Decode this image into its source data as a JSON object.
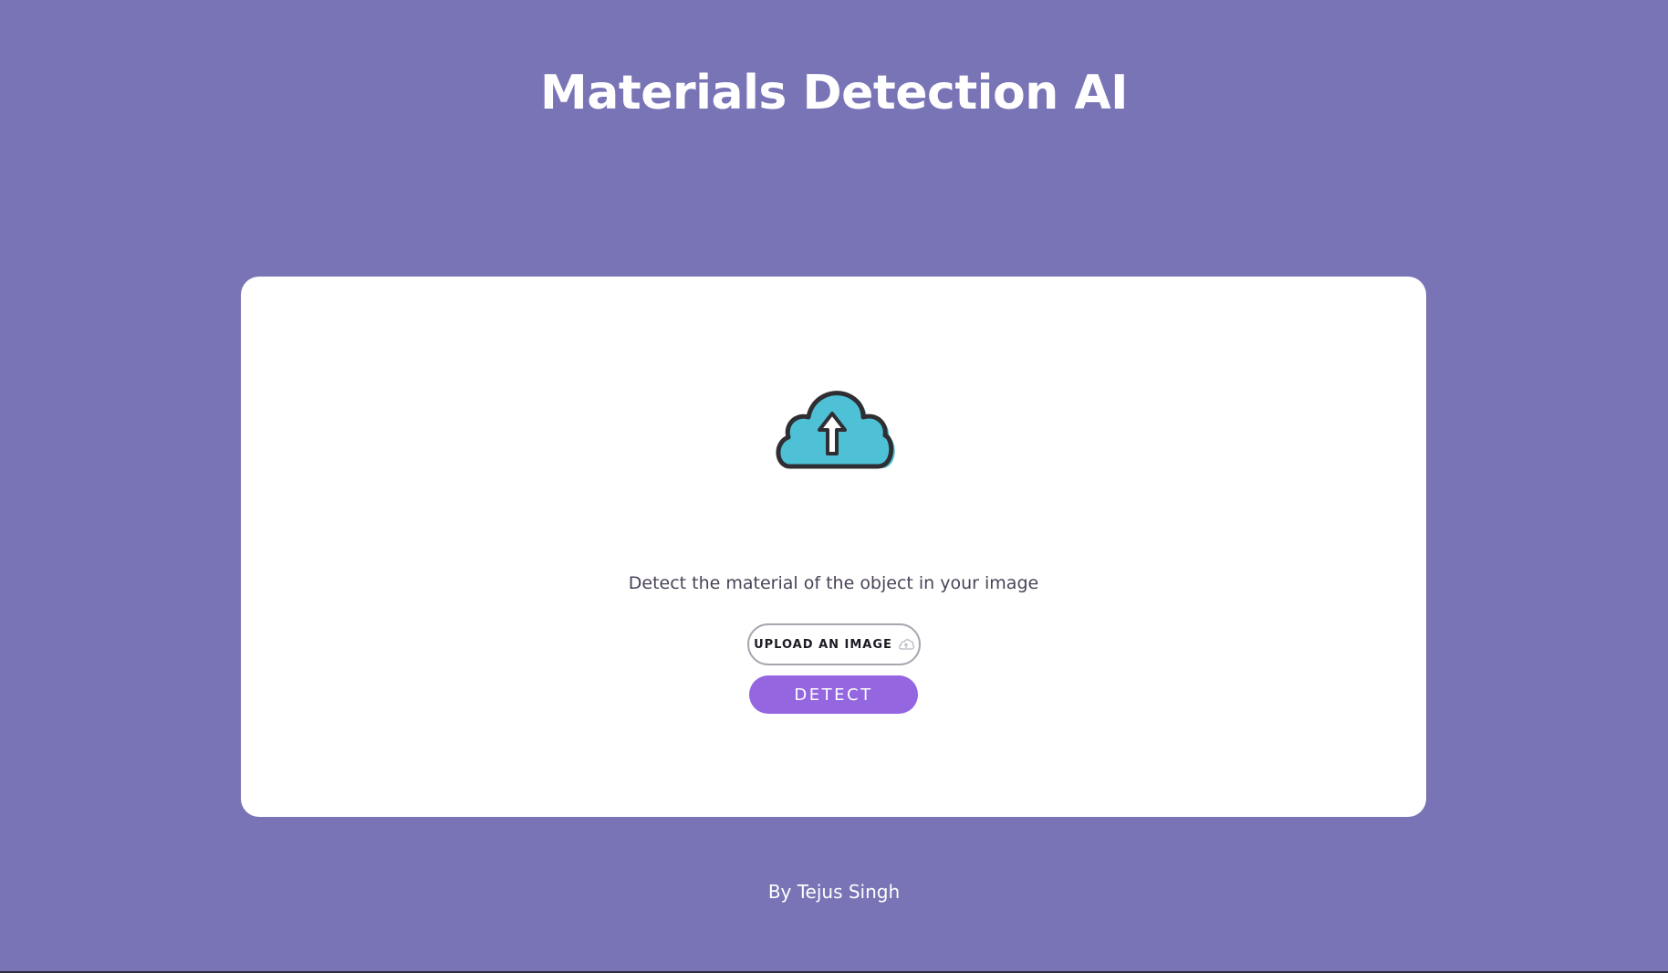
{
  "header": {
    "title": "Materials Detection AI"
  },
  "card": {
    "hero_icon": "cloud-upload-icon",
    "tagline": "Detect the material of the object in your image",
    "upload_label": "UPLOAD AN IMAGE",
    "upload_icon": "small-cloud-upload-icon",
    "detect_label": "DETECT"
  },
  "footer": {
    "credit": "By Tejus Singh"
  },
  "colors": {
    "background": "#7974b5",
    "card": "#ffffff",
    "accent": "#9466e0",
    "cloud_fill": "#4ec1d6",
    "cloud_outline": "#2f2f33"
  }
}
